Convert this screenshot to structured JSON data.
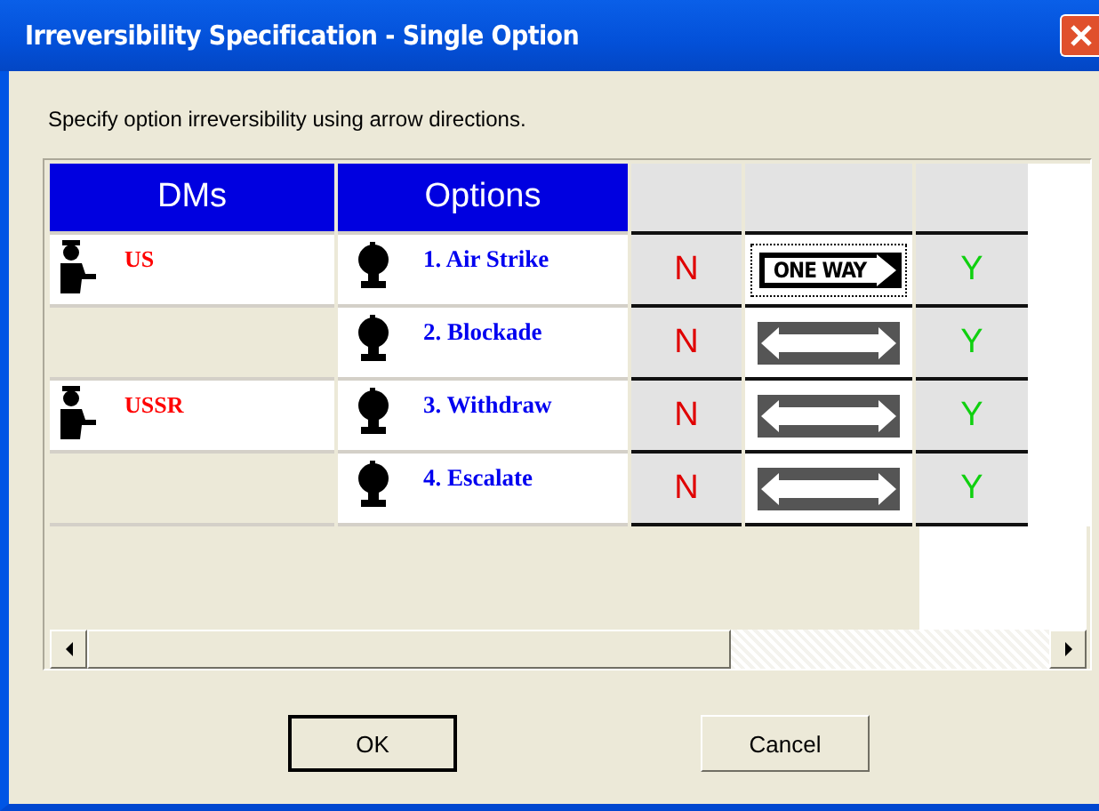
{
  "window": {
    "title": "Irreversibility Specification - Single Option"
  },
  "instruction": "Specify option irreversibility using arrow directions.",
  "columns": [
    "DMs",
    "Options"
  ],
  "rows": [
    {
      "dm": "US",
      "option": "1. Air Strike",
      "from": "N",
      "to": "Y",
      "arrow": {
        "kind": "one_way",
        "label": "ONE WAY"
      },
      "focused": true
    },
    {
      "option": "2. Blockade",
      "from": "N",
      "to": "Y",
      "arrow": {
        "kind": "two_way"
      },
      "focused": false
    },
    {
      "dm": "USSR",
      "option": "3. Withdraw",
      "from": "N",
      "to": "Y",
      "arrow": {
        "kind": "two_way"
      },
      "focused": false
    },
    {
      "option": "4. Escalate",
      "from": "N",
      "to": "Y",
      "arrow": {
        "kind": "two_way"
      },
      "focused": false
    }
  ],
  "buttons": [
    "OK",
    "Cancel"
  ]
}
